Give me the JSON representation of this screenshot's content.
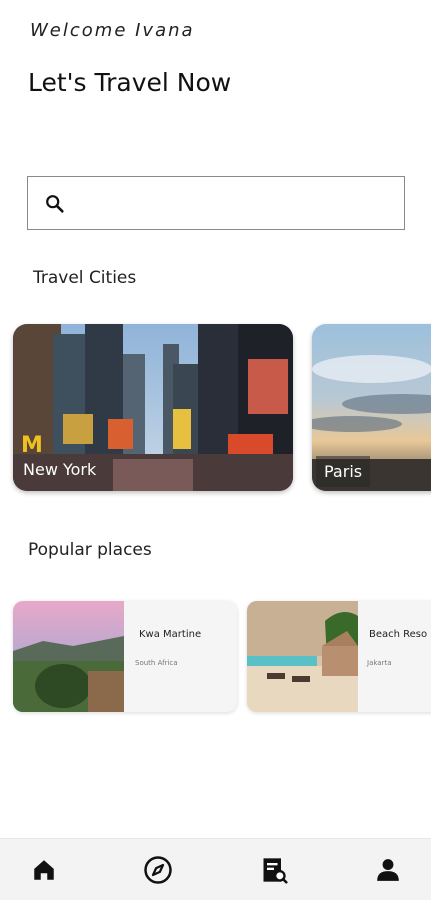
{
  "header": {
    "welcome": "Welcome Ivana",
    "headline": "Let's Travel Now"
  },
  "search": {
    "placeholder": "",
    "value": ""
  },
  "travel_cities": {
    "title": "Travel Cities",
    "cities": [
      {
        "label": "New York"
      },
      {
        "label": "Paris"
      }
    ]
  },
  "popular_places": {
    "title": "Popular places",
    "places": [
      {
        "name": "Kwa Martine",
        "location": "South Africa"
      },
      {
        "name": "Beach Reso",
        "location": "Jakarta"
      }
    ]
  },
  "bottom_nav": {
    "items": [
      "home-icon",
      "explore-icon",
      "bookings-icon",
      "profile-icon"
    ]
  }
}
